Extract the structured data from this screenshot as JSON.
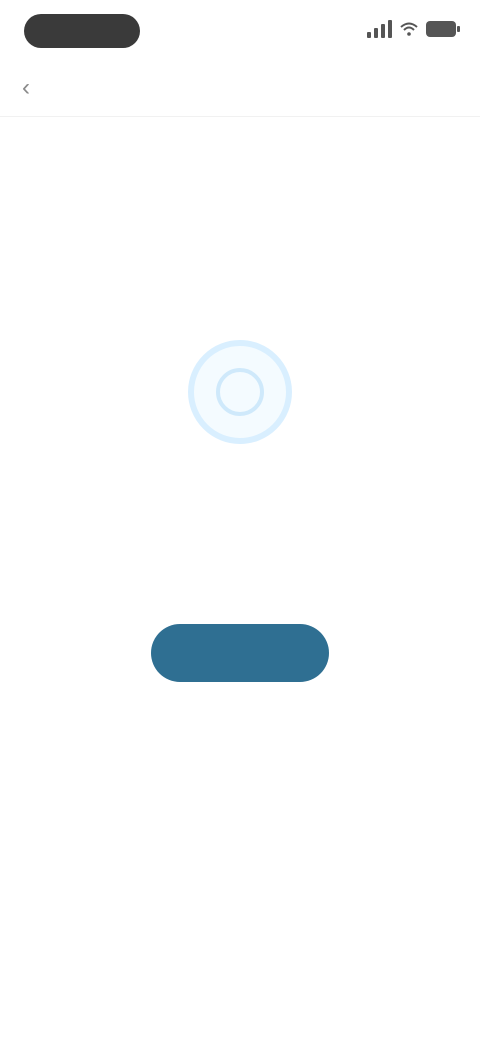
{
  "status_bar": {
    "icons": [
      "signal-icon",
      "wifi-icon",
      "battery-icon"
    ]
  },
  "nav": {
    "back_icon": "chevron-left-icon",
    "title": ""
  },
  "main": {
    "icon": "status-ring-icon",
    "headline": "",
    "description": "",
    "button_label": ""
  },
  "colors": {
    "accent": "#2f6f92",
    "ring": "#d9efff",
    "background": "#ffffff"
  }
}
